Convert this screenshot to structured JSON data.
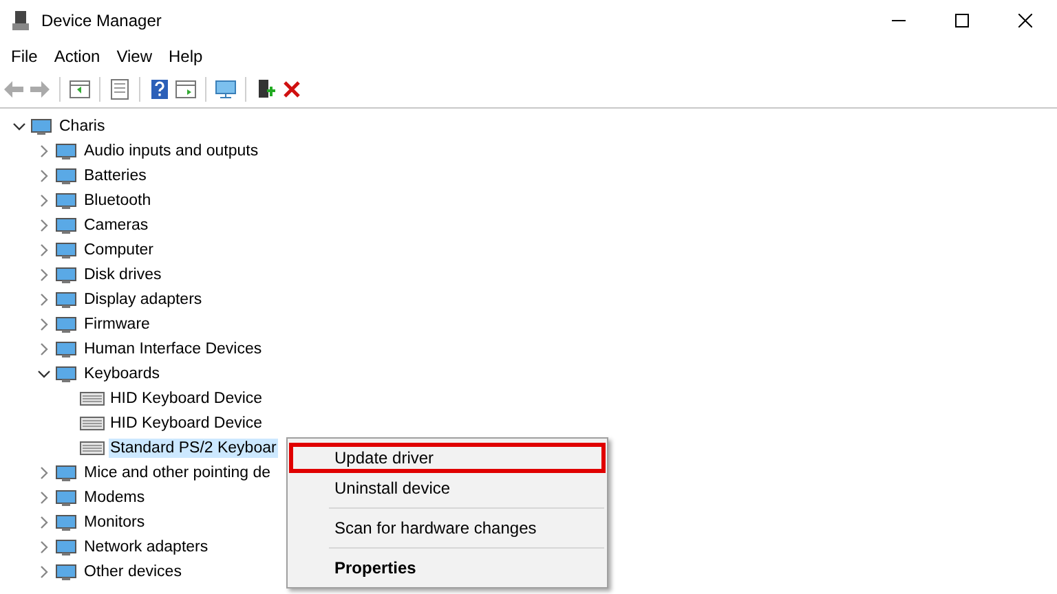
{
  "window": {
    "title": "Device Manager"
  },
  "menu": [
    "File",
    "Action",
    "View",
    "Help"
  ],
  "tree": [
    {
      "label": "Charis",
      "expanded": true,
      "selected": false,
      "children": [
        {
          "label": "Audio inputs and outputs",
          "expanded": false,
          "selected": false
        },
        {
          "label": "Batteries",
          "expanded": false,
          "selected": false
        },
        {
          "label": "Bluetooth",
          "expanded": false,
          "selected": false
        },
        {
          "label": "Cameras",
          "expanded": false,
          "selected": false
        },
        {
          "label": "Computer",
          "expanded": false,
          "selected": false
        },
        {
          "label": "Disk drives",
          "expanded": false,
          "selected": false
        },
        {
          "label": "Display adapters",
          "expanded": false,
          "selected": false
        },
        {
          "label": "Firmware",
          "expanded": false,
          "selected": false
        },
        {
          "label": "Human Interface Devices",
          "expanded": false,
          "selected": false
        },
        {
          "label": "Keyboards",
          "expanded": true,
          "selected": false,
          "children": [
            {
              "label": "HID Keyboard Device",
              "selected": false
            },
            {
              "label": "HID Keyboard Device",
              "selected": false
            },
            {
              "label": "Standard PS/2 Keyboar",
              "selected": true
            }
          ]
        },
        {
          "label": "Mice and other pointing de",
          "expanded": false,
          "selected": false
        },
        {
          "label": "Modems",
          "expanded": false,
          "selected": false
        },
        {
          "label": "Monitors",
          "expanded": false,
          "selected": false
        },
        {
          "label": "Network adapters",
          "expanded": false,
          "selected": false
        },
        {
          "label": "Other devices",
          "expanded": false,
          "selected": false
        }
      ]
    }
  ],
  "context_menu": [
    {
      "label": "Update driver",
      "highlighted": true,
      "bold": false
    },
    {
      "label": "Uninstall device",
      "highlighted": false,
      "bold": false
    },
    {
      "label": "Scan for hardware changes",
      "highlighted": false,
      "bold": false
    },
    {
      "label": "Properties",
      "highlighted": false,
      "bold": true
    }
  ]
}
